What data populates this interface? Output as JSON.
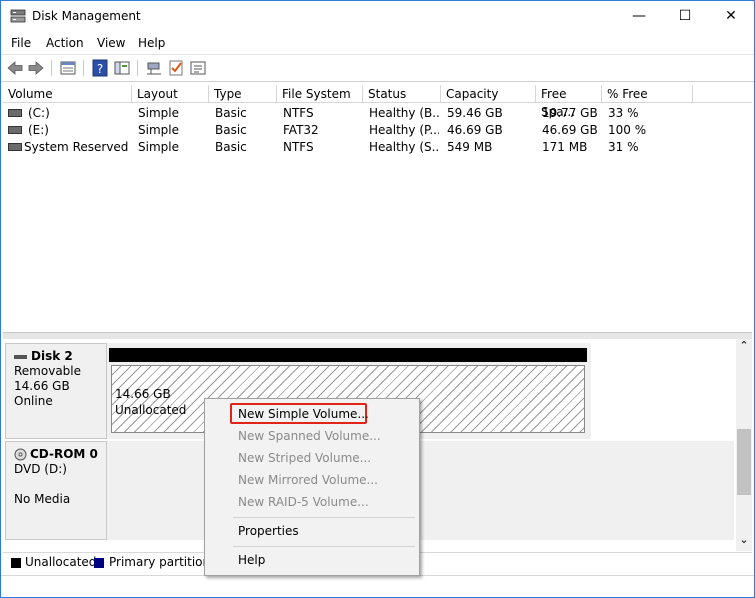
{
  "window": {
    "title": "Disk Management",
    "minimize_glyph": "—",
    "maximize_glyph": "☐",
    "close_glyph": "✕"
  },
  "menu": [
    "File",
    "Action",
    "View",
    "Help"
  ],
  "toolbar": {
    "icons": [
      "back-arrow-icon",
      "forward-arrow-icon",
      "disk-list-icon",
      "help-icon",
      "console-tree-icon",
      "connect-icon",
      "check-icon",
      "properties-icon"
    ]
  },
  "volume_table": {
    "columns": [
      "Volume",
      "Layout",
      "Type",
      "File System",
      "Status",
      "Capacity",
      "Free Spa...",
      "% Free"
    ],
    "rows": [
      [
        "(C:)",
        "Simple",
        "Basic",
        "NTFS",
        "Healthy (B...",
        "59.46 GB",
        "19.77 GB",
        "33 %"
      ],
      [
        "(E:)",
        "Simple",
        "Basic",
        "FAT32",
        "Healthy (P...",
        "46.69 GB",
        "46.69 GB",
        "100 %"
      ],
      [
        "System Reserved",
        "Simple",
        "Basic",
        "NTFS",
        "Healthy (S...",
        "549 MB",
        "171 MB",
        "31 %"
      ]
    ]
  },
  "disks": [
    {
      "name": "Disk 2",
      "type": "Removable",
      "size": "14.66 GB",
      "state": "Online",
      "partition_size": "14.66 GB",
      "partition_label": "Unallocated"
    },
    {
      "name": "CD-ROM 0",
      "type": "DVD (D:)",
      "state": "No Media"
    }
  ],
  "legend": [
    {
      "label": "Unallocated",
      "color": "#000000"
    },
    {
      "label": "Primary partition",
      "color": "#000080"
    }
  ],
  "context_menu": {
    "items": [
      {
        "label": "New Simple Volume...",
        "enabled": true
      },
      {
        "label": "New Spanned Volume...",
        "enabled": false
      },
      {
        "label": "New Striped Volume...",
        "enabled": false
      },
      {
        "label": "New Mirrored Volume...",
        "enabled": false
      },
      {
        "label": "New RAID-5 Volume...",
        "enabled": false
      },
      {
        "label": "Properties",
        "enabled": true
      },
      {
        "label": "Help",
        "enabled": true
      }
    ],
    "highlight_color": "#e2231a"
  },
  "scrollbar": {
    "up_glyph": "⌃",
    "down_glyph": "⌄"
  }
}
